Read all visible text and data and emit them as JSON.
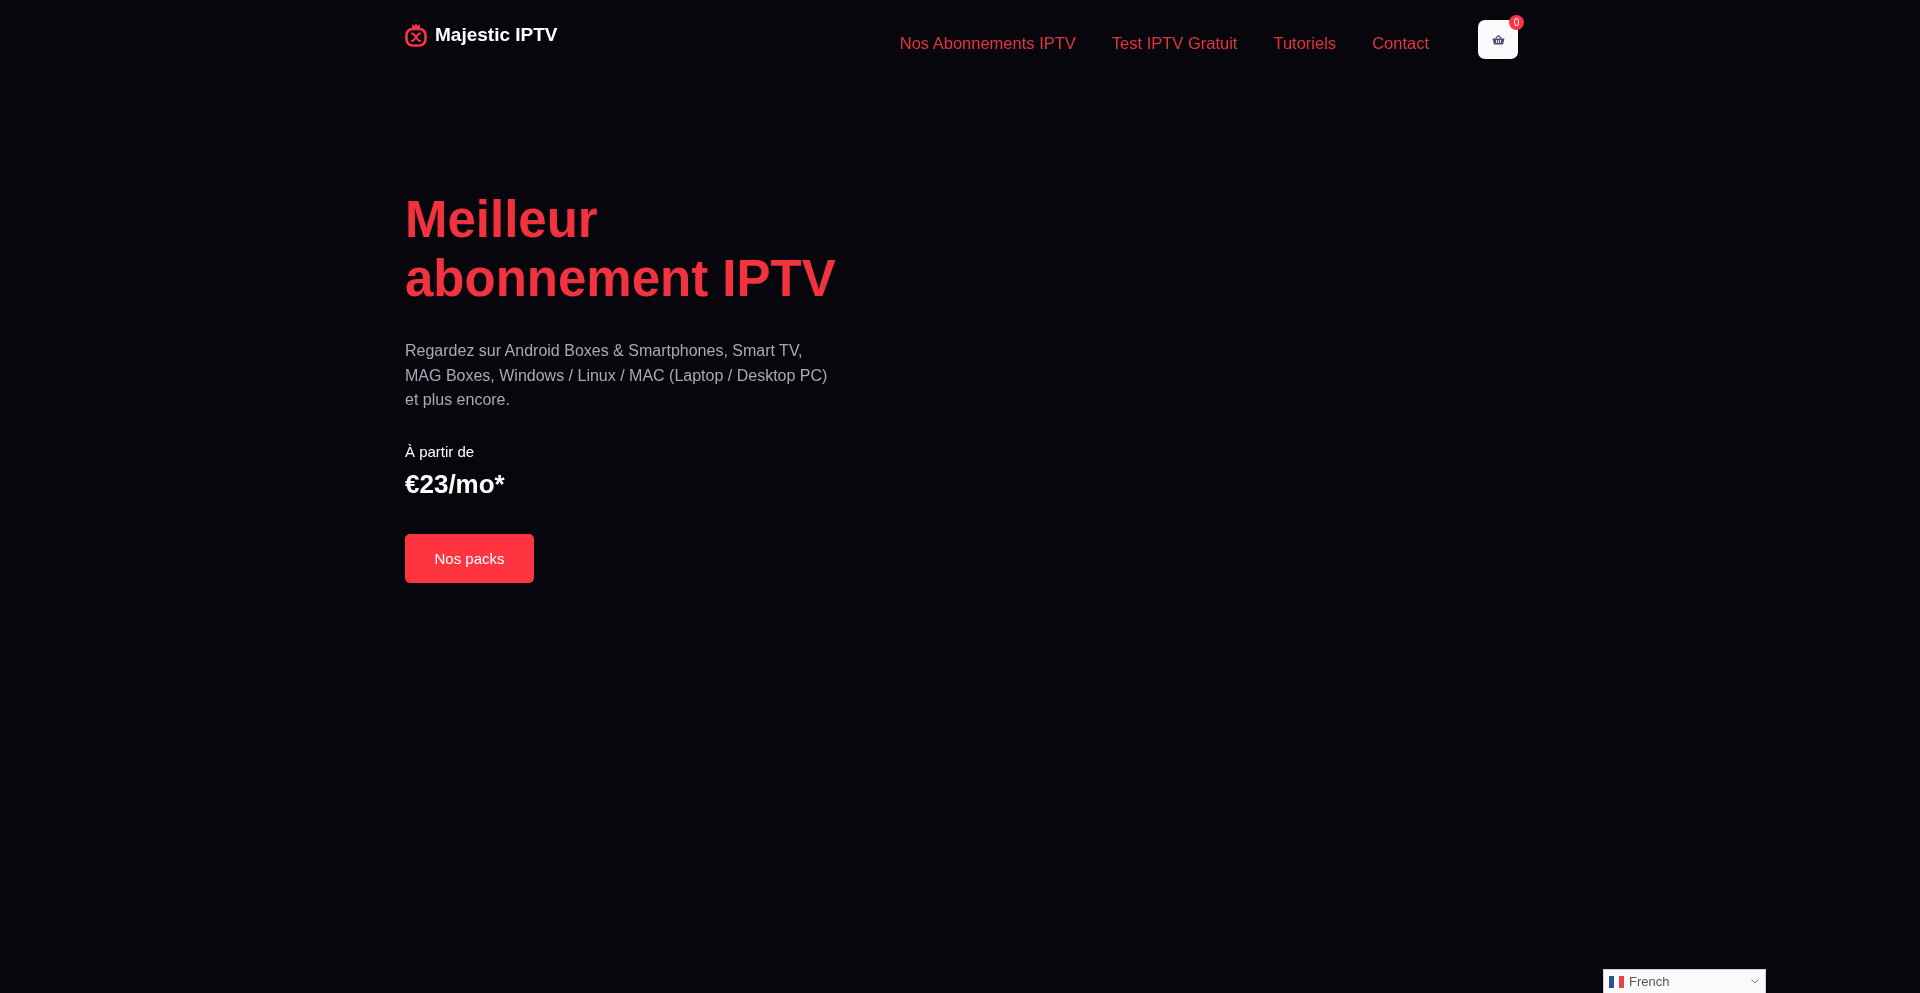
{
  "header": {
    "logo": {
      "text": "Majestic IPTV"
    },
    "nav": [
      "Nos Abonnements IPTV",
      "Test IPTV Gratuit",
      "Tutoriels",
      "Contact"
    ],
    "cart": {
      "count": "0"
    }
  },
  "hero": {
    "title": "Meilleur abonnement IPTV",
    "description": "Regardez sur Android Boxes & Smartphones, Smart TV, MAG Boxes, Windows / Linux / MAC (Laptop / Desktop PC) et plus encore.",
    "price_caption": "À partir de",
    "price": "€23/mo*",
    "button": "Nos packs"
  },
  "language_select": {
    "value": "French"
  }
}
